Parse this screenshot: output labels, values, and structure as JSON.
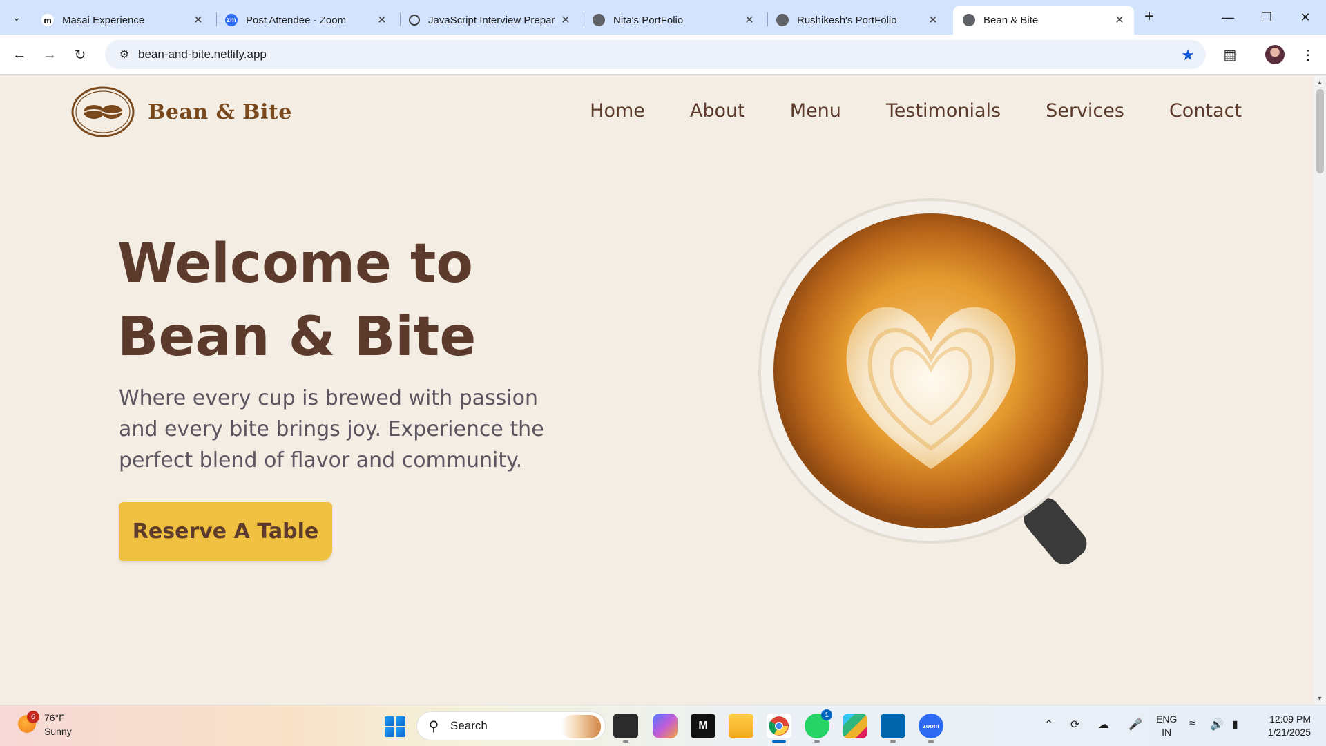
{
  "browser": {
    "tabs": [
      {
        "title": "Masai Experience",
        "favicon": "m",
        "favicon_color": "#ffffff",
        "favicon_text_color": "#1f1f1f",
        "active": false
      },
      {
        "title": "Post Attendee - Zoom",
        "favicon": "zm",
        "favicon_color": "#2d6cf2",
        "favicon_text_color": "#ffffff",
        "active": false
      },
      {
        "title": "JavaScript Interview Prepar",
        "favicon": "openai-icon",
        "favicon_color": "#d3e3fd",
        "favicon_text_color": "#1f1f1f",
        "active": false
      },
      {
        "title": "Nita's PortFolio",
        "favicon": "globe-icon",
        "favicon_color": "#5f6368",
        "favicon_text_color": "#ffffff",
        "active": false
      },
      {
        "title": "Rushikesh's PortFolio",
        "favicon": "globe-icon",
        "favicon_color": "#5f6368",
        "favicon_text_color": "#ffffff",
        "active": false
      },
      {
        "title": "Bean & Bite",
        "favicon": "globe-icon",
        "favicon_color": "#5f6368",
        "favicon_text_color": "#ffffff",
        "active": true
      }
    ],
    "url": "bean-and-bite.netlify.app",
    "bookmarked": true,
    "accent": "#0b57d0"
  },
  "site": {
    "brand": "Bean & Bite",
    "nav": [
      "Home",
      "About",
      "Menu",
      "Testimonials",
      "Services",
      "Contact"
    ],
    "hero": {
      "title_line1": "Welcome to",
      "title_line2": "Bean & Bite",
      "subtitle": "Where every cup is brewed with passion and every bite brings joy. Experience the perfect blend of flavor and community.",
      "cta": "Reserve A Table"
    },
    "colors": {
      "background": "#f3ede3",
      "heading": "#5c3a2c",
      "cta": "#f0c040",
      "logo": "#7a4a1e"
    }
  },
  "taskbar": {
    "weather": {
      "temp": "76°F",
      "condition": "Sunny",
      "badge": "6"
    },
    "search_label": "Search",
    "apps": [
      {
        "name": "file-explorer-stack-icon"
      },
      {
        "name": "copilot-icon"
      },
      {
        "name": "masai-icon"
      },
      {
        "name": "folder-icon"
      },
      {
        "name": "chrome-icon"
      },
      {
        "name": "whatsapp-icon",
        "badge": "1"
      },
      {
        "name": "slack-icon"
      },
      {
        "name": "vscode-icon"
      },
      {
        "name": "zoom-icon"
      }
    ],
    "lang_line1": "ENG",
    "lang_line2": "IN",
    "time": "12:09 PM",
    "date": "1/21/2025"
  }
}
